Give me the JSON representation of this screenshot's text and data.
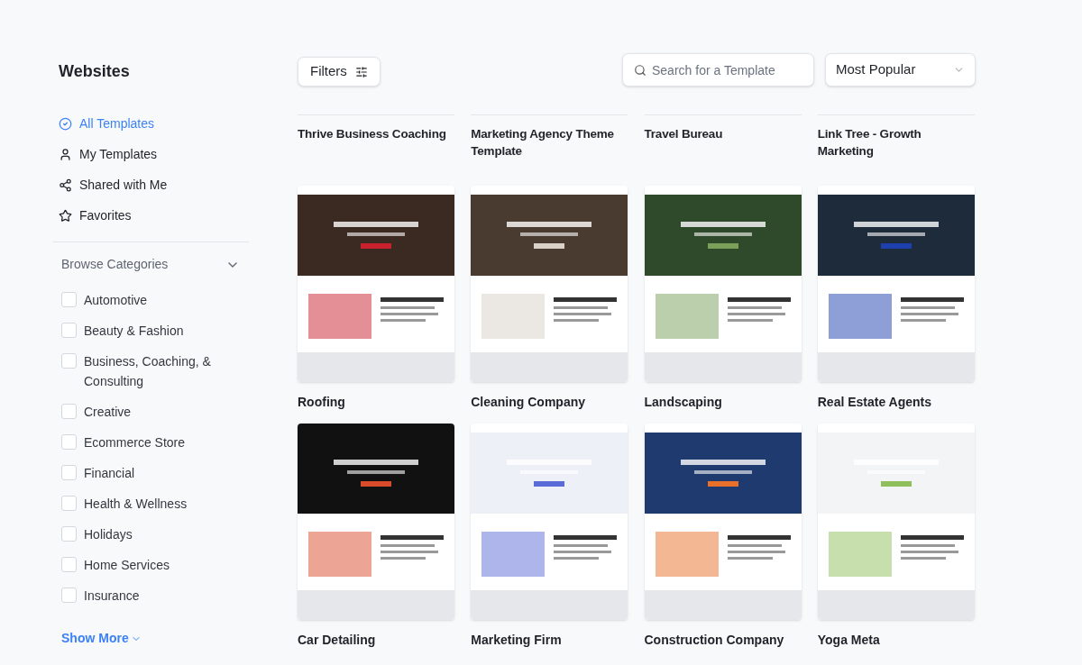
{
  "sidebar": {
    "title": "Websites",
    "nav": [
      {
        "label": "All Templates",
        "selected": true
      },
      {
        "label": "My Templates",
        "selected": false
      },
      {
        "label": "Shared with Me",
        "selected": false
      },
      {
        "label": "Favorites",
        "selected": false
      }
    ],
    "categories": {
      "title": "Browse Categories",
      "expanded": true,
      "items": [
        {
          "label": "Automotive",
          "checked": false
        },
        {
          "label": "Beauty & Fashion",
          "checked": false
        },
        {
          "label": "Business, Coaching, & Consulting",
          "checked": false
        },
        {
          "label": "Creative",
          "checked": false
        },
        {
          "label": "Ecommerce Store",
          "checked": false
        },
        {
          "label": "Financial",
          "checked": false
        },
        {
          "label": "Health & Wellness",
          "checked": false
        },
        {
          "label": "Holidays",
          "checked": false
        },
        {
          "label": "Home Services",
          "checked": false
        },
        {
          "label": "Insurance",
          "checked": false
        }
      ],
      "show_more": "Show More"
    }
  },
  "toolbar": {
    "filters": "Filters",
    "search": {
      "placeholder": "Search for a Template"
    },
    "sort": "Most Popular"
  },
  "templates_cut": [
    {
      "title": "Thrive Business Coaching"
    },
    {
      "title": "Marketing Agency Theme Template"
    },
    {
      "title": "Travel Bureau"
    },
    {
      "title": "Link Tree - Growth Marketing"
    }
  ],
  "templates": [
    {
      "title": "Roofing"
    },
    {
      "title": "Cleaning Company"
    },
    {
      "title": "Landscaping"
    },
    {
      "title": "Real Estate Agents"
    },
    {
      "title": "Car Detailing"
    },
    {
      "title": "Marketing Firm"
    },
    {
      "title": "Construction Company"
    },
    {
      "title": "Yoga Meta"
    }
  ]
}
